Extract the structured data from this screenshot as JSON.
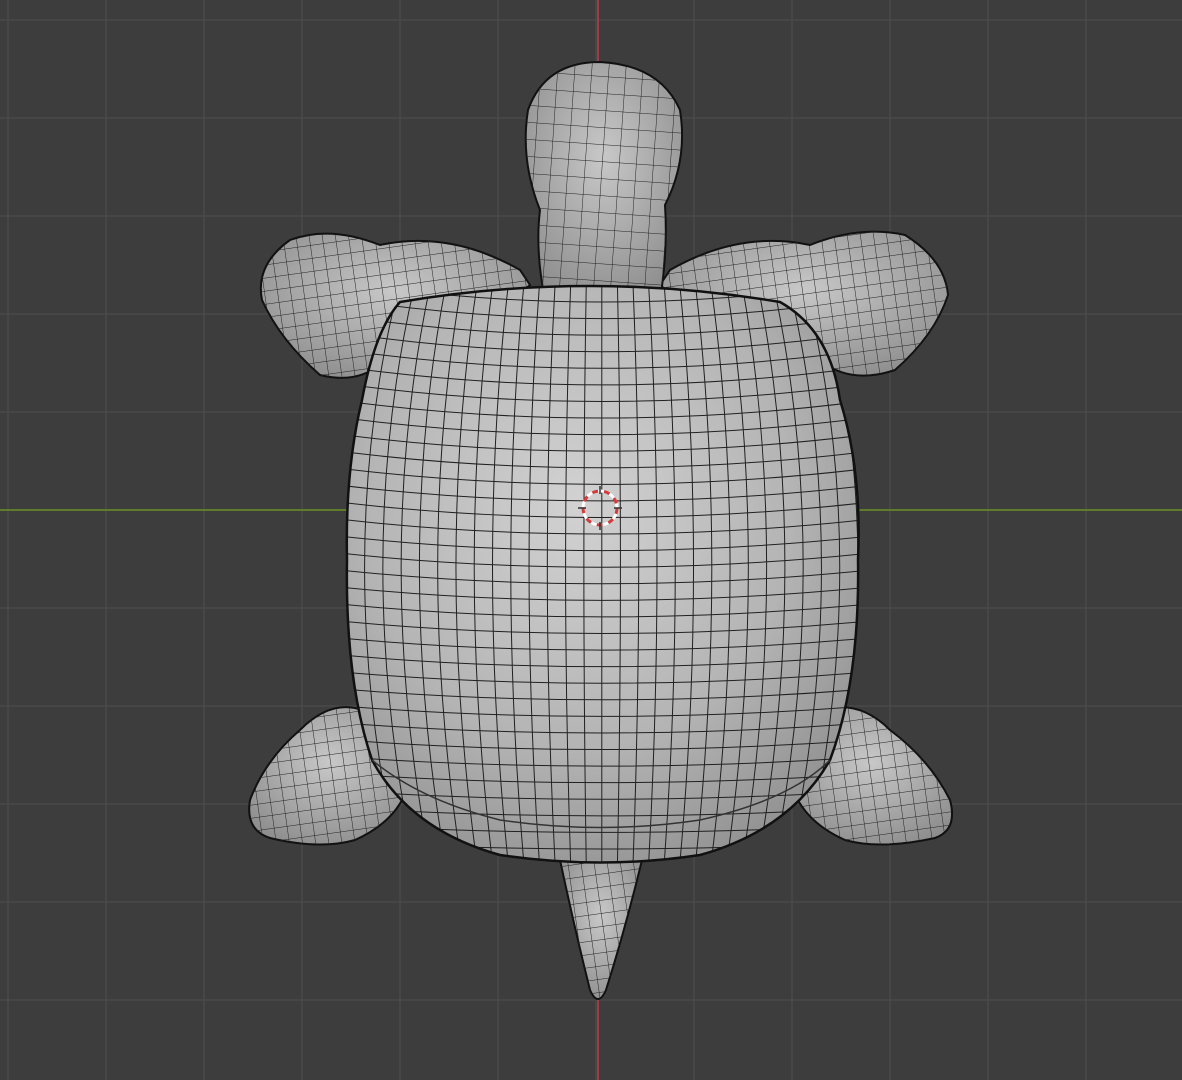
{
  "viewport": {
    "background_color": "#3d3d3d",
    "grid_color": "#4a4a4a",
    "x_axis_color": "#6b8e23",
    "y_axis_color": "#c0394b",
    "grid_visible": true
  },
  "object": {
    "type": "turtle-mesh",
    "shading": "solid-wireframe",
    "fill_color": "#b8b8b8",
    "wire_color": "#202020",
    "outline_color": "#111111"
  },
  "cursor_3d": {
    "icon": "3d-cursor-icon",
    "ring_color_primary": "#d23c3c",
    "ring_color_secondary": "#ffffff"
  }
}
